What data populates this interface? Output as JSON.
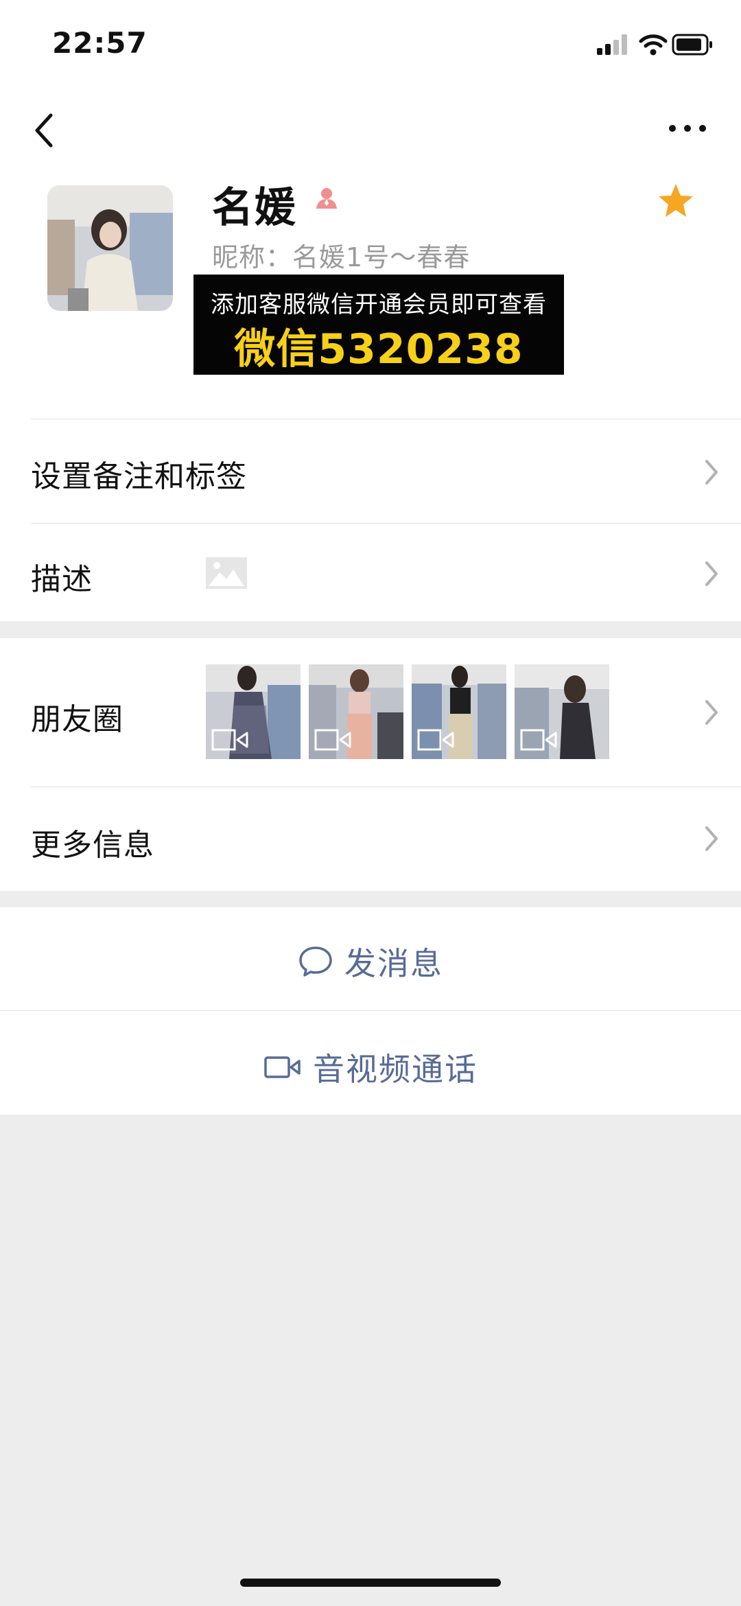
{
  "status_bar": {
    "time": "22:57"
  },
  "profile": {
    "name": "名媛",
    "nickname_prefix": "昵称：",
    "nickname": "名媛1号～春春"
  },
  "ad": {
    "line1": "添加客服微信开通会员即可查看",
    "line2": "微信5320238"
  },
  "rows": {
    "remark": "设置备注和标签",
    "description": "描述",
    "moments": "朋友圈",
    "more_info": "更多信息"
  },
  "actions": {
    "message": "发消息",
    "video_call": "音视频通话"
  },
  "colors": {
    "link_blue": "#576b95",
    "star_orange": "#f5a623",
    "ad_yellow": "#f7d018",
    "background": "#ededed"
  }
}
